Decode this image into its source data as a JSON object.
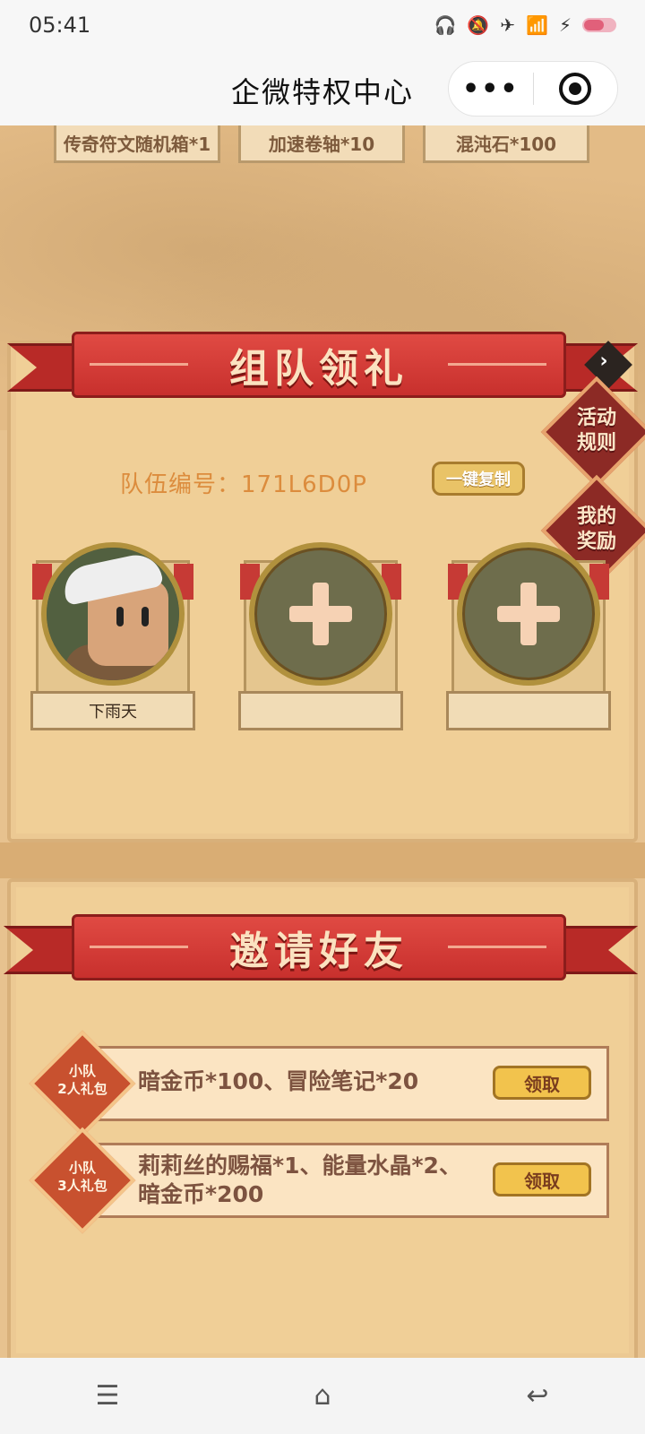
{
  "status": {
    "time": "05:41"
  },
  "nav": {
    "title": "企微特权中心",
    "more": "•••"
  },
  "top_rewards": [
    "传奇符文随机箱*1",
    "加速卷轴*10",
    "混沌石*100"
  ],
  "team_section": {
    "title": "组队领礼",
    "team_id_label": "队伍编号：",
    "team_id": "171L6D0P",
    "copy_button": "一键复制",
    "side_rules": "活动\n规则",
    "side_rewards": "我的\n奖励",
    "members": [
      {
        "name": "下雨天",
        "filled": true
      },
      {
        "name": "",
        "filled": false
      },
      {
        "name": "",
        "filled": false
      }
    ]
  },
  "invite_section": {
    "title": "邀请好友",
    "gifts": [
      {
        "badge": "小队\n2人礼包",
        "text": "暗金币*100、冒险笔记*20",
        "button": "领取"
      },
      {
        "badge": "小队\n3人礼包",
        "text": "莉莉丝的赐福*1、能量水晶*2、\n暗金币*200",
        "button": "领取"
      }
    ]
  }
}
